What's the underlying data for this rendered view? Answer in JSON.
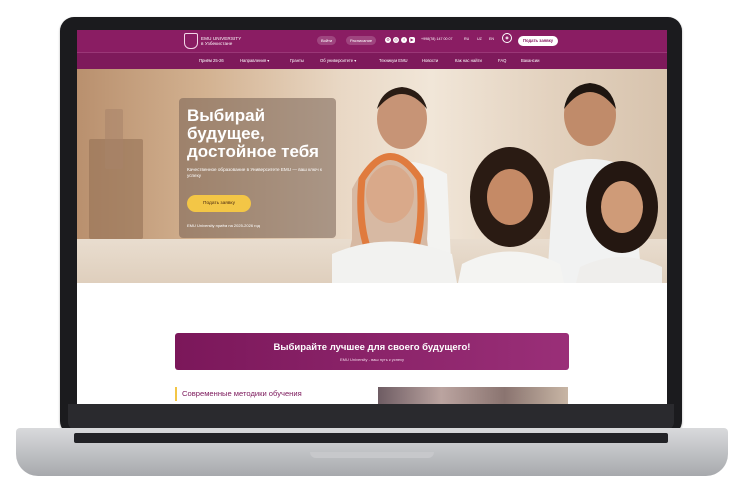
{
  "topbar": {
    "logo_line1": "EMU UNIVERSITY",
    "logo_line2": "в Узбекистане",
    "login_label": "Войти",
    "schedule_label": "Расписание",
    "phone": "+998(78) 147 00 07",
    "languages": [
      "RU",
      "UZ",
      "EN"
    ],
    "cta_label": "Подать заявку"
  },
  "nav": {
    "items": [
      "Приём 25-26",
      "Направления",
      "Гранты",
      "Об университете",
      "Техникум EMU",
      "Новости",
      "Как нас найти",
      "FAQ",
      "Вакансии"
    ]
  },
  "hero": {
    "title": "Выбирай\nбудущее,\nдостойное тебя",
    "subtitle": "Качественное образование в Университете EMU — ваш ключ к успеху",
    "button_label": "Подать заявку",
    "note": "EMU University приём на 2025-2026 год"
  },
  "banner": {
    "title": "Выбирайте лучшее для своего будущего!",
    "subtitle": "EMU University - ваш путь к успеху"
  },
  "section": {
    "methods_title": "Современные методики обучения"
  },
  "colors": {
    "brand": "#8a1d63",
    "accent": "#f3c646"
  },
  "icons": [
    "shield-logo-icon",
    "settings-icon",
    "instagram-icon",
    "facebook-icon",
    "youtube-icon",
    "eye-icon"
  ]
}
